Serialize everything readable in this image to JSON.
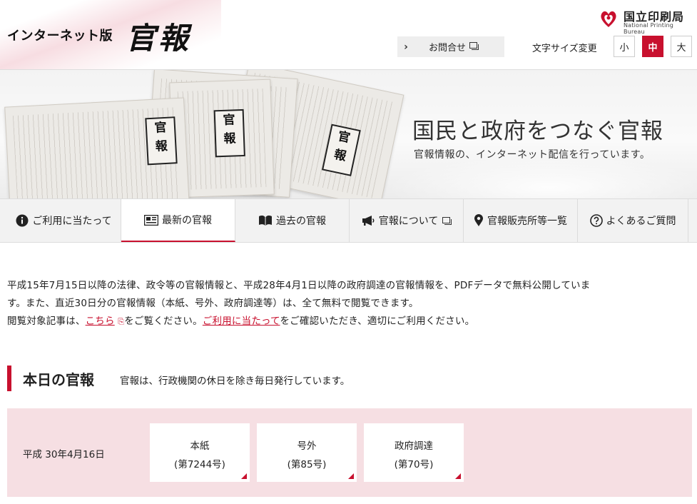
{
  "header": {
    "logo_small": "インターネット版",
    "logo_big": "官報",
    "org_name_ja": "国立印刷局",
    "org_name_en": "National Printing Bureau",
    "contact_label": "お問合せ",
    "font_size_label": "文字サイズ変更",
    "font_sizes": [
      "小",
      "中",
      "大"
    ],
    "font_size_selected": "中"
  },
  "hero": {
    "title": "国民と政府をつなぐ官報",
    "subtitle": "官報情報の、インターネット配信を行っています。"
  },
  "nav": [
    {
      "label": "ご利用に当たって",
      "icon": "info-icon"
    },
    {
      "label": "最新の官報",
      "icon": "newspaper-icon",
      "active": true
    },
    {
      "label": "過去の官報",
      "icon": "book-icon"
    },
    {
      "label": "官報について",
      "icon": "megaphone-icon",
      "external": true
    },
    {
      "label": "官報販売所等一覧",
      "icon": "map-pin-icon"
    },
    {
      "label": "よくあるご質問",
      "icon": "question-icon"
    }
  ],
  "intro": {
    "line1": "平成15年7月15日以降の法律、政令等の官報情報と、平成28年4月1日以降の政府調達の官報情報を、PDFデータで無料公開していま",
    "line2": "す。また、直近30日分の官報情報（本紙、号外、政府調達等）は、全て無料で閲覧できます。",
    "line3_pre": "閲覧対象記事は、",
    "line3_link1": "こちら",
    "line3_mid": "をご覧ください。",
    "line3_link2": "ご利用に当たって",
    "line3_post": "をご確認いただき、適切にご利用ください。"
  },
  "today": {
    "title": "本日の官報",
    "description": "官報は、行政機関の休日を除き毎日発行しています。",
    "date": "平成 30年4月16日",
    "issues": [
      {
        "name": "本紙",
        "number": "(第7244号)"
      },
      {
        "name": "号外",
        "number": "(第85号)"
      },
      {
        "name": "政府調達",
        "number": "(第70号)"
      }
    ]
  },
  "colors": {
    "accent": "#c8102e",
    "panel_pink": "#f6dfe3",
    "nav_bg": "#f2f2f2"
  }
}
